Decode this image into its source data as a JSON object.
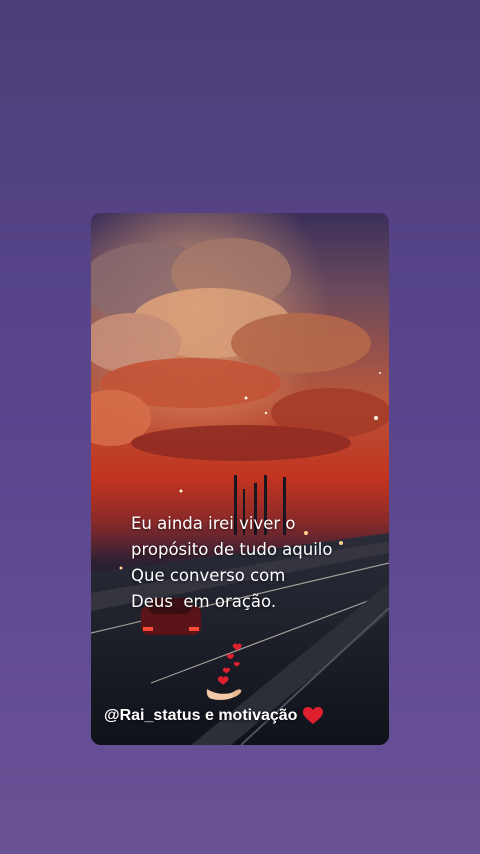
{
  "story": {
    "quote_lines": [
      "Eu ainda irei viver o",
      "propósito de tudo aquilo",
      "Que converso com",
      "Deus  em oração."
    ],
    "watermark": "@Rai_status e motivação",
    "icons": [
      "heart-hand-icon",
      "red-heart-icon"
    ],
    "colors": {
      "background_top": "#4c3e78",
      "background_bottom": "#6a5296",
      "sky_red": "#c2331f",
      "heart_red": "#e0202e"
    }
  }
}
